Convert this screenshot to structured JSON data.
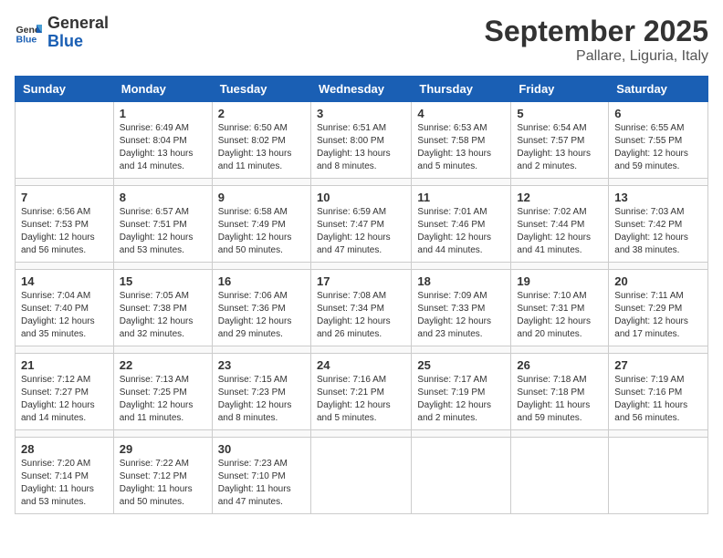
{
  "header": {
    "logo_general": "General",
    "logo_blue": "Blue",
    "month_title": "September 2025",
    "location": "Pallare, Liguria, Italy"
  },
  "weekdays": [
    "Sunday",
    "Monday",
    "Tuesday",
    "Wednesday",
    "Thursday",
    "Friday",
    "Saturday"
  ],
  "weeks": [
    [
      {
        "day": "",
        "info": ""
      },
      {
        "day": "1",
        "info": "Sunrise: 6:49 AM\nSunset: 8:04 PM\nDaylight: 13 hours\nand 14 minutes."
      },
      {
        "day": "2",
        "info": "Sunrise: 6:50 AM\nSunset: 8:02 PM\nDaylight: 13 hours\nand 11 minutes."
      },
      {
        "day": "3",
        "info": "Sunrise: 6:51 AM\nSunset: 8:00 PM\nDaylight: 13 hours\nand 8 minutes."
      },
      {
        "day": "4",
        "info": "Sunrise: 6:53 AM\nSunset: 7:58 PM\nDaylight: 13 hours\nand 5 minutes."
      },
      {
        "day": "5",
        "info": "Sunrise: 6:54 AM\nSunset: 7:57 PM\nDaylight: 13 hours\nand 2 minutes."
      },
      {
        "day": "6",
        "info": "Sunrise: 6:55 AM\nSunset: 7:55 PM\nDaylight: 12 hours\nand 59 minutes."
      }
    ],
    [
      {
        "day": "7",
        "info": "Sunrise: 6:56 AM\nSunset: 7:53 PM\nDaylight: 12 hours\nand 56 minutes."
      },
      {
        "day": "8",
        "info": "Sunrise: 6:57 AM\nSunset: 7:51 PM\nDaylight: 12 hours\nand 53 minutes."
      },
      {
        "day": "9",
        "info": "Sunrise: 6:58 AM\nSunset: 7:49 PM\nDaylight: 12 hours\nand 50 minutes."
      },
      {
        "day": "10",
        "info": "Sunrise: 6:59 AM\nSunset: 7:47 PM\nDaylight: 12 hours\nand 47 minutes."
      },
      {
        "day": "11",
        "info": "Sunrise: 7:01 AM\nSunset: 7:46 PM\nDaylight: 12 hours\nand 44 minutes."
      },
      {
        "day": "12",
        "info": "Sunrise: 7:02 AM\nSunset: 7:44 PM\nDaylight: 12 hours\nand 41 minutes."
      },
      {
        "day": "13",
        "info": "Sunrise: 7:03 AM\nSunset: 7:42 PM\nDaylight: 12 hours\nand 38 minutes."
      }
    ],
    [
      {
        "day": "14",
        "info": "Sunrise: 7:04 AM\nSunset: 7:40 PM\nDaylight: 12 hours\nand 35 minutes."
      },
      {
        "day": "15",
        "info": "Sunrise: 7:05 AM\nSunset: 7:38 PM\nDaylight: 12 hours\nand 32 minutes."
      },
      {
        "day": "16",
        "info": "Sunrise: 7:06 AM\nSunset: 7:36 PM\nDaylight: 12 hours\nand 29 minutes."
      },
      {
        "day": "17",
        "info": "Sunrise: 7:08 AM\nSunset: 7:34 PM\nDaylight: 12 hours\nand 26 minutes."
      },
      {
        "day": "18",
        "info": "Sunrise: 7:09 AM\nSunset: 7:33 PM\nDaylight: 12 hours\nand 23 minutes."
      },
      {
        "day": "19",
        "info": "Sunrise: 7:10 AM\nSunset: 7:31 PM\nDaylight: 12 hours\nand 20 minutes."
      },
      {
        "day": "20",
        "info": "Sunrise: 7:11 AM\nSunset: 7:29 PM\nDaylight: 12 hours\nand 17 minutes."
      }
    ],
    [
      {
        "day": "21",
        "info": "Sunrise: 7:12 AM\nSunset: 7:27 PM\nDaylight: 12 hours\nand 14 minutes."
      },
      {
        "day": "22",
        "info": "Sunrise: 7:13 AM\nSunset: 7:25 PM\nDaylight: 12 hours\nand 11 minutes."
      },
      {
        "day": "23",
        "info": "Sunrise: 7:15 AM\nSunset: 7:23 PM\nDaylight: 12 hours\nand 8 minutes."
      },
      {
        "day": "24",
        "info": "Sunrise: 7:16 AM\nSunset: 7:21 PM\nDaylight: 12 hours\nand 5 minutes."
      },
      {
        "day": "25",
        "info": "Sunrise: 7:17 AM\nSunset: 7:19 PM\nDaylight: 12 hours\nand 2 minutes."
      },
      {
        "day": "26",
        "info": "Sunrise: 7:18 AM\nSunset: 7:18 PM\nDaylight: 11 hours\nand 59 minutes."
      },
      {
        "day": "27",
        "info": "Sunrise: 7:19 AM\nSunset: 7:16 PM\nDaylight: 11 hours\nand 56 minutes."
      }
    ],
    [
      {
        "day": "28",
        "info": "Sunrise: 7:20 AM\nSunset: 7:14 PM\nDaylight: 11 hours\nand 53 minutes."
      },
      {
        "day": "29",
        "info": "Sunrise: 7:22 AM\nSunset: 7:12 PM\nDaylight: 11 hours\nand 50 minutes."
      },
      {
        "day": "30",
        "info": "Sunrise: 7:23 AM\nSunset: 7:10 PM\nDaylight: 11 hours\nand 47 minutes."
      },
      {
        "day": "",
        "info": ""
      },
      {
        "day": "",
        "info": ""
      },
      {
        "day": "",
        "info": ""
      },
      {
        "day": "",
        "info": ""
      }
    ]
  ]
}
